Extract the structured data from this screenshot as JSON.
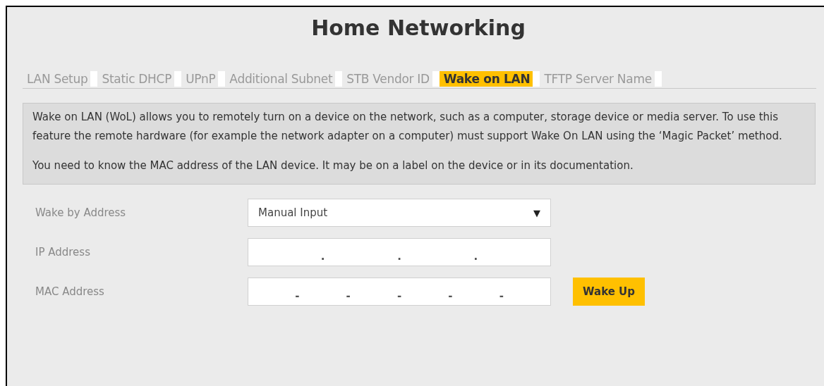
{
  "page": {
    "title": "Home Networking"
  },
  "tabs": [
    {
      "label": "LAN Setup",
      "selected": false
    },
    {
      "label": "Static DHCP",
      "selected": false
    },
    {
      "label": "UPnP",
      "selected": false
    },
    {
      "label": "Additional Subnet",
      "selected": false
    },
    {
      "label": "STB Vendor ID",
      "selected": false
    },
    {
      "label": "Wake on LAN",
      "selected": true
    },
    {
      "label": "TFTP Server Name",
      "selected": false
    }
  ],
  "description": [
    "Wake on LAN (WoL) allows you to remotely turn on a device on the network, such as a computer, storage device or media server. To use this feature the remote hardware (for example the network adapter on a computer) must support Wake On LAN using the ‘Magic Packet’ method.",
    "You need to know the MAC address of the LAN device. It may be on a label on the device or in its documentation."
  ],
  "form": [
    {
      "kind": "dropdown",
      "label": "Wake by Address",
      "value": "Manual Input",
      "caret": "▼"
    },
    {
      "kind": "segments",
      "label": "IP Address",
      "separators": [
        ".",
        ".",
        "."
      ]
    },
    {
      "kind": "segments",
      "label": "MAC Address",
      "separators": [
        "-",
        "-",
        "-",
        "-",
        "-"
      ],
      "button": "Wake Up"
    }
  ]
}
